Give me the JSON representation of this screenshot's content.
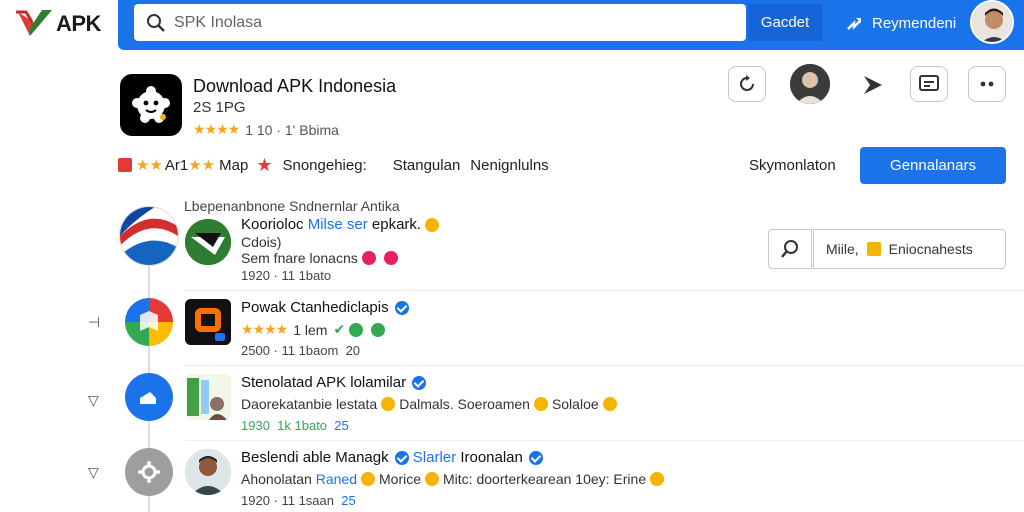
{
  "header": {
    "logo_text": "APK",
    "search_placeholder": "SPK Inolasa",
    "search_button": "Gacdet",
    "report_label": "Reymendeni"
  },
  "app": {
    "title": "Download APK Indonesia",
    "meta": "2S 1PG",
    "rating_stars": "★★★★",
    "rating_text": "1 10 · 1' Bbima"
  },
  "tabs": {
    "items": [
      "Ar1",
      "Map",
      "Snongehieg:",
      "Stangulan",
      "Nenignlulns"
    ],
    "stars_text": "★★",
    "stars_after": "★★",
    "sign_label": "Skymonlaton",
    "primary_button": "Gennalanars"
  },
  "subhead": "Lbepenanbnone Sndnernlar Antika",
  "side": {
    "field_text": "Miile,",
    "field_label": "Eniocnahests"
  },
  "feed": [
    {
      "title_a": "Koorioloc",
      "title_b": "Milse ser",
      "title_c": "epkark.",
      "line2": "Cdois)",
      "line3a": "Sem fnare lonacns",
      "line4": "1920 · 11 1bato"
    },
    {
      "title": "Powak Ctanhediclapis",
      "line2_stars": "★★★★",
      "line2_text": "1 lem",
      "line3": "2500 · 11 1baom",
      "line3_count": "20"
    },
    {
      "title": "Stenolatad APK lolamilar",
      "line2a": "Daorekatanbie lestata",
      "line2b": "Dalmals. Soeroamen",
      "line2c": "Solaloe",
      "line3_green": "1930",
      "line3_time": "1k 1bato",
      "line3_count": "25"
    },
    {
      "title": "Beslendi able Managk",
      "title_b": "Slarler",
      "title_c": "Iroonalan",
      "line2a": "Ahonolatan",
      "line2b": "Raned",
      "line2c": "Morice",
      "line2d": "Mitc: doorterkearean 10ey: Erine",
      "line3": "1920 · 11 1saan",
      "line3_count": "25"
    }
  ],
  "colors": {
    "brand_blue": "#1a73e8",
    "star": "#f5a623",
    "red": "#e53935",
    "green": "#34a853"
  }
}
